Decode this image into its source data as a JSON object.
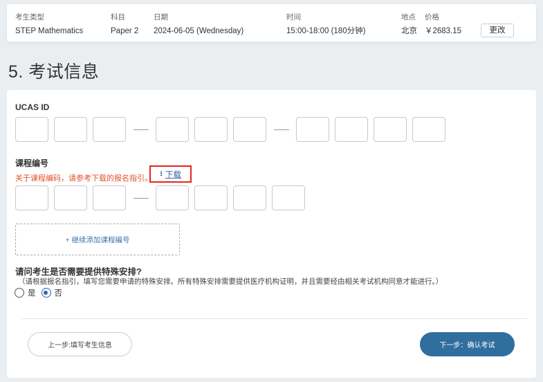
{
  "summary": {
    "columns": [
      {
        "label": "考生类型",
        "value": "STEP Mathematics"
      },
      {
        "label": "科目",
        "value": "Paper 2"
      },
      {
        "label": "日期",
        "value": "2024-06-05 (Wednesday)"
      },
      {
        "label": "时间",
        "value": "15:00-18:00 (180分钟)"
      },
      {
        "label": "地点",
        "value": "北京"
      },
      {
        "label": "价格",
        "value": "￥2683.15"
      }
    ],
    "change_label": "更改"
  },
  "section": {
    "title": "5. 考试信息"
  },
  "ucas": {
    "label": "UCAS ID",
    "groups": [
      3,
      3,
      4
    ],
    "values": [
      "",
      "",
      "",
      "",
      "",
      "",
      "",
      "",
      "",
      ""
    ]
  },
  "course_code": {
    "label": "课程编号",
    "hint": "关于课程编码，请参考下载的报名指引。",
    "download_label": "下载",
    "download_icon": "download-icon",
    "groups": [
      3,
      4
    ],
    "values": [
      "",
      "",
      "",
      "",
      "",
      "",
      ""
    ],
    "add_more_label": "+ 继续添加课程编号"
  },
  "special_arrangement": {
    "question": "请问考生是否需要提供特殊安排?",
    "note": "（请根据报名指引，填写您需要申请的特殊安排。所有特殊安排需要提供医疗机构证明，并且需要经由相关考试机构同意才能进行。）",
    "options": [
      {
        "label": "是",
        "checked": false
      },
      {
        "label": "否",
        "checked": true
      }
    ]
  },
  "nav": {
    "prev_label": "上一步:填写考生信息",
    "next_label": "下一步：确认考试"
  },
  "colors": {
    "accent": "#306e9e",
    "hint": "#e0522a",
    "highlight_border": "#e8241c",
    "link": "#2d6aa6"
  }
}
